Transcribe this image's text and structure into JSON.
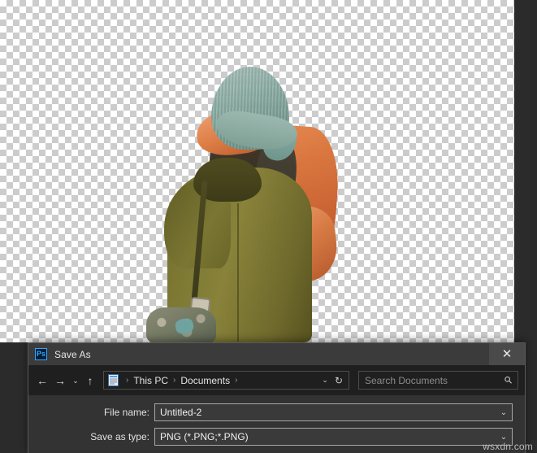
{
  "canvas": {
    "background": "transparent-checkerboard",
    "checker_colors": [
      "#ffffff",
      "#cccccc"
    ],
    "artwork_description": "person-from-behind-cutout",
    "surround_color": "#2b2b2b"
  },
  "dialog": {
    "app_icon": "photoshop-ps-icon",
    "title": "Save As",
    "close_label": "✕",
    "accent_color": "#31a8ff",
    "background": "#333333",
    "titlebar_background": "#3b3b3b"
  },
  "navigation": {
    "back_icon": "←",
    "forward_icon": "→",
    "recent_icon": "⌄",
    "up_icon": "↑",
    "breadcrumb": {
      "folder_icon": "documents-folder-icon",
      "separator": "›",
      "items": [
        {
          "label": "This PC"
        },
        {
          "label": "Documents"
        }
      ],
      "trailing_separator": "›",
      "dropdown_icon": "⌄",
      "refresh_icon": "↻"
    },
    "search": {
      "placeholder": "Search Documents",
      "value": "",
      "icon": "search-icon"
    }
  },
  "form": {
    "rows": [
      {
        "label": "File name:",
        "value": "Untitled-2",
        "arrow": "⌄"
      },
      {
        "label": "Save as type:",
        "value": "PNG (*.PNG;*.PNG)",
        "arrow": "⌄"
      }
    ]
  },
  "watermark": {
    "text": "wsxdn.com"
  }
}
